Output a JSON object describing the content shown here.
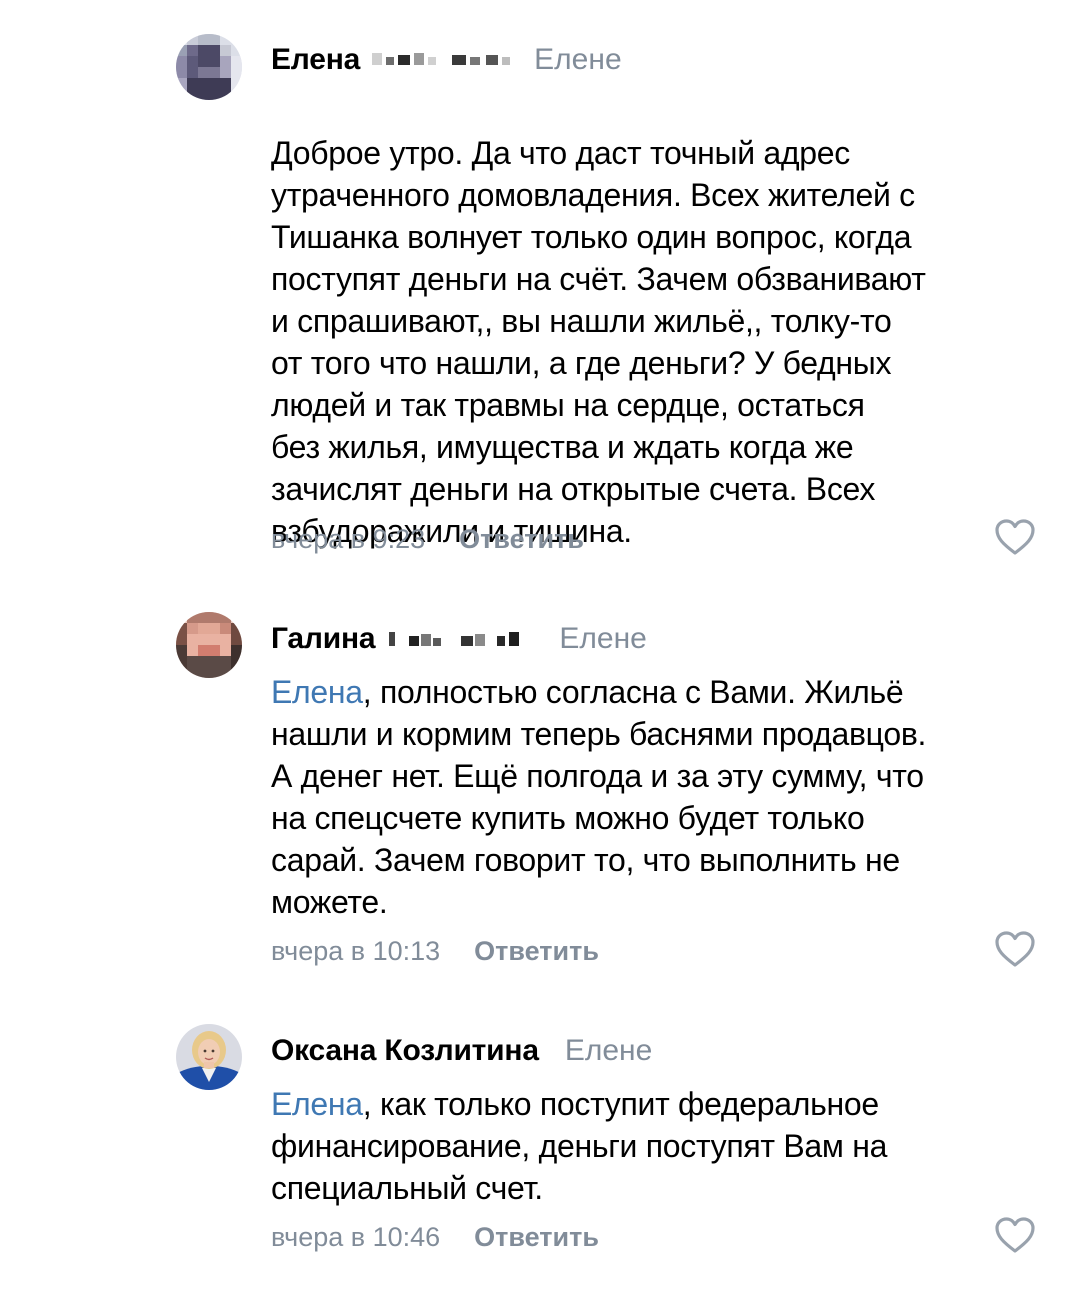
{
  "comments": [
    {
      "author": "Елена",
      "reply_to": "Елене",
      "mention": "",
      "text": "Доброе утро. Да что даст точный адрес\nутраченного домовладения. Всех жителей с\nТишанка волнует только один вопрос, когда\nпоступят деньги на счёт. Зачем обзванивают\nи спрашивают,, вы нашли жильё,, толку-то\nот того что нашли, а где деньги? У бедных\nлюдей и так травмы на сердце, остаться\nбез жилья, имущества и ждать когда же\nзачислят деньги на открытые счета. Всех\nвзбудоражили и тишина.",
      "time": "вчера в 9:23",
      "reply_label": "Ответить",
      "avatar_icon": "pixelated-avatar-icon"
    },
    {
      "author": "Галина",
      "reply_to": "Елене",
      "mention": "Елена",
      "text": ", полностью согласна с Вами. Жильё\nнашли и кормим теперь баснями продавцов.\nА денег нет. Ещё полгода и за эту сумму, что\nна спецсчете купить можно будет только\nсарай. Зачем говорит то, что выполнить не\nможете.",
      "time": "вчера в 10:13",
      "reply_label": "Ответить",
      "avatar_icon": "pixelated-avatar-icon"
    },
    {
      "author": "Оксана Козлитина",
      "reply_to": "Елене",
      "mention": "Елена",
      "text": ", как только поступит федеральное\nфинансирование, деньги поступят Вам на\nспециальный счет.",
      "time": "вчера в 10:46",
      "reply_label": "Ответить",
      "avatar_icon": "user-photo-avatar-icon"
    }
  ],
  "colors": {
    "secondary_text": "#818c99",
    "mention": "#3f78b3",
    "primary_text": "#000000",
    "background": "#ffffff"
  },
  "icons": {
    "like": "heart-outline-icon"
  }
}
